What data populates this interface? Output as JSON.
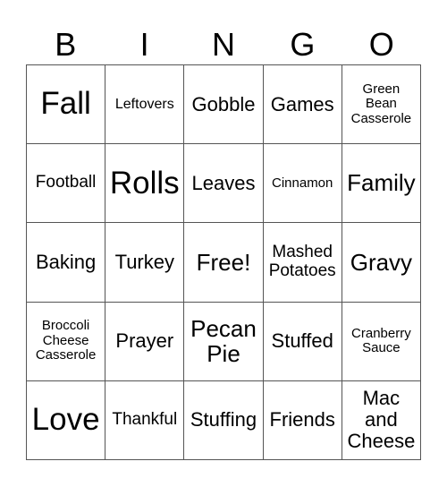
{
  "header": {
    "letters": [
      "B",
      "I",
      "N",
      "G",
      "O"
    ]
  },
  "cells": [
    [
      "Fall",
      "Leftovers",
      "Gobble",
      "Games",
      "Green Bean Casserole"
    ],
    [
      "Football",
      "Rolls",
      "Leaves",
      "Cinnamon",
      "Family"
    ],
    [
      "Baking",
      "Turkey",
      "Free!",
      "Mashed Potatoes",
      "Gravy"
    ],
    [
      "Broccoli Cheese Casserole",
      "Prayer",
      "Pecan Pie",
      "Stuffed",
      "Cranberry Sauce"
    ],
    [
      "Love",
      "Thankful",
      "Stuffing",
      "Friends",
      "Mac and Cheese"
    ]
  ]
}
